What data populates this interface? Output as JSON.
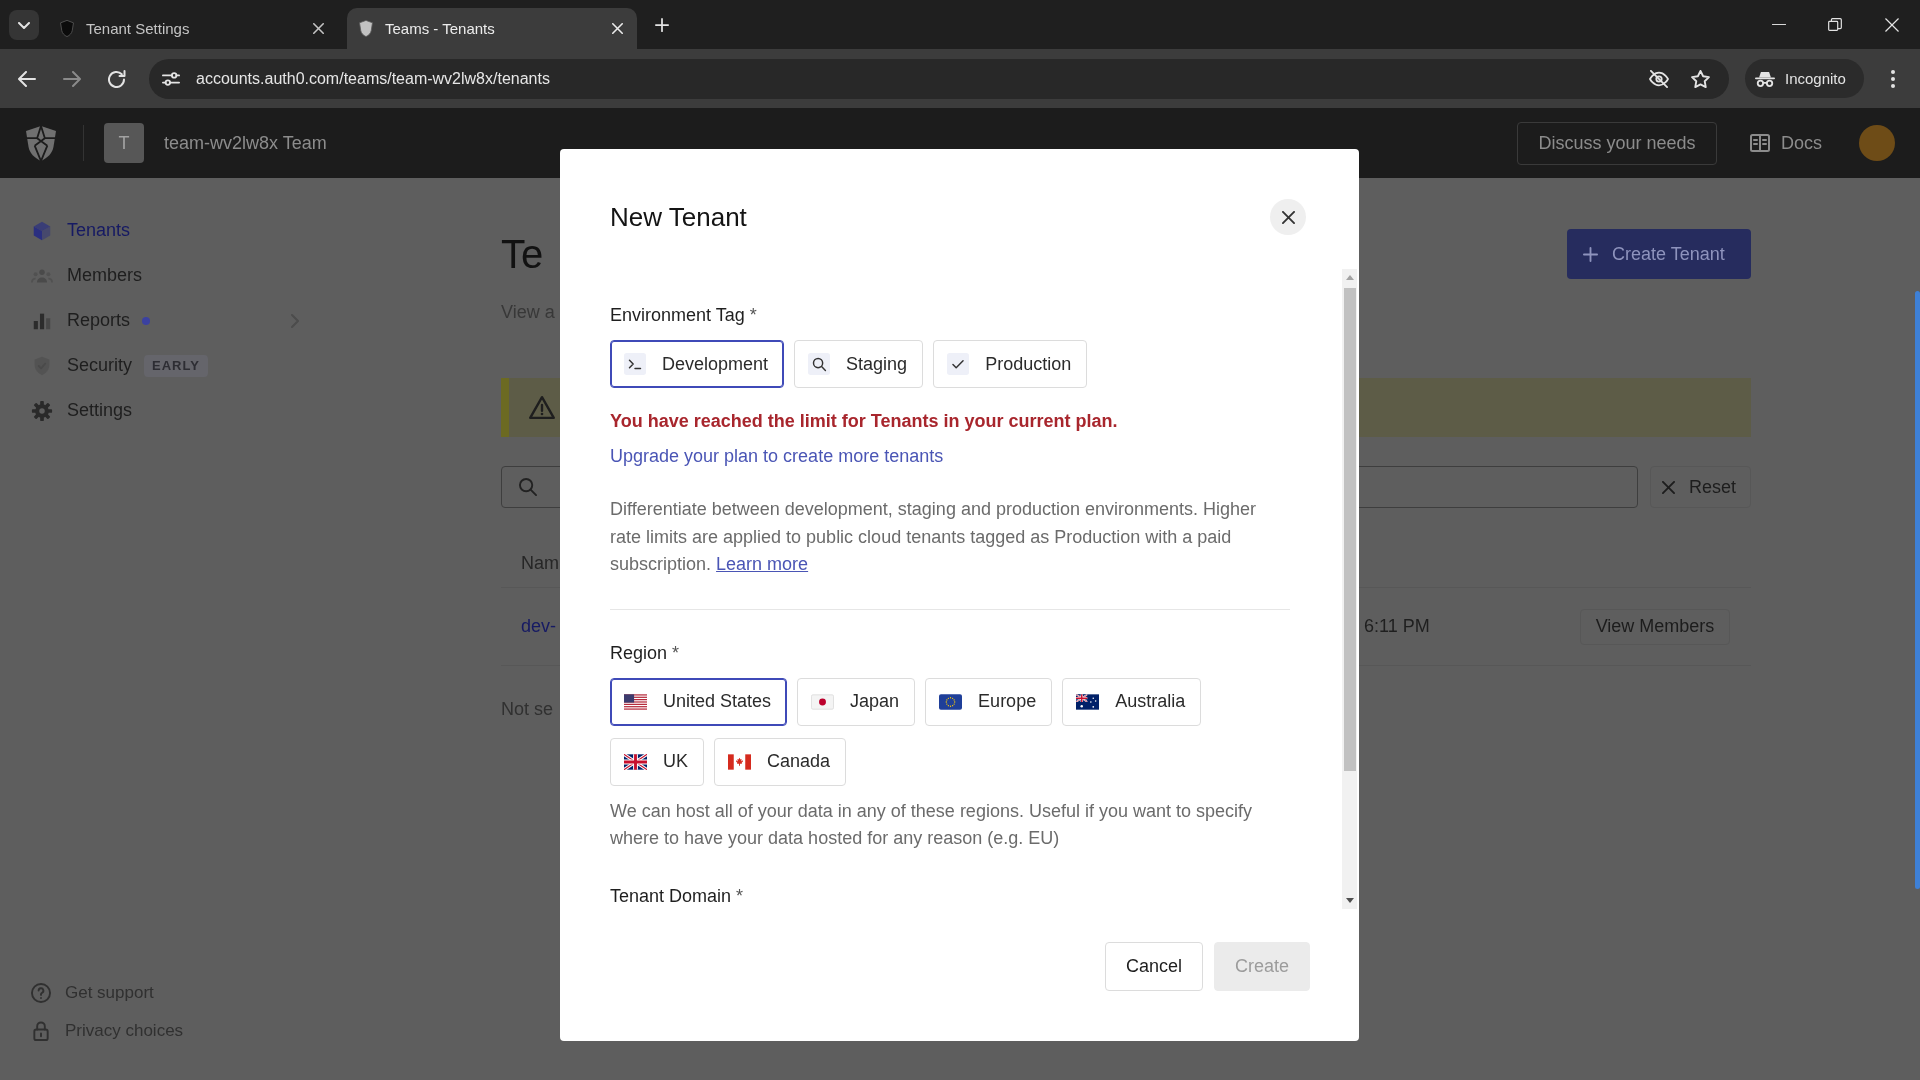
{
  "browser": {
    "tabs": [
      {
        "title": "Tenant Settings",
        "selected": false
      },
      {
        "title": "Teams - Tenants",
        "selected": true
      }
    ],
    "address": "accounts.auth0.com/teams/team-wv2lw8x/tenants",
    "profile": "Incognito"
  },
  "header": {
    "team_initial": "T",
    "team_name": "team-wv2lw8x Team",
    "discuss_button": "Discuss your needs",
    "docs_link": "Docs"
  },
  "sidebar": {
    "items": [
      {
        "label": "Tenants",
        "selected": true,
        "dot": false,
        "expandable": false
      },
      {
        "label": "Members",
        "selected": false,
        "dot": false,
        "expandable": false
      },
      {
        "label": "Reports",
        "selected": false,
        "dot": true,
        "expandable": true
      },
      {
        "label": "Security",
        "selected": false,
        "dot": false,
        "expandable": false,
        "badge": "EARLY"
      },
      {
        "label": "Settings",
        "selected": false,
        "dot": false,
        "expandable": false
      }
    ],
    "footer_links": [
      "Get support",
      "Privacy choices"
    ]
  },
  "page": {
    "title": "Te",
    "subtitle": "View a",
    "create_button": "Create Tenant",
    "reset_button": "Reset",
    "table": {
      "columns": [
        "Nam"
      ],
      "rows": [
        {
          "cells": [
            "dev-",
            "6:11 PM"
          ],
          "action": "View Members"
        }
      ]
    },
    "footer_note": "Not se"
  },
  "dialog": {
    "title": "New Tenant",
    "environment": {
      "label": "Environment Tag",
      "required_mark": "*",
      "options": [
        {
          "label": "Development",
          "selected": true
        },
        {
          "label": "Staging",
          "selected": false
        },
        {
          "label": "Production",
          "selected": false
        }
      ],
      "error": "You have reached the limit for Tenants in your current plan.",
      "upgrade_link": "Upgrade your plan to create more tenants",
      "help": "Differentiate between development, staging and production environments. Higher rate limits are applied to public cloud tenants tagged as Production with a paid subscription.",
      "help_link": "Learn more"
    },
    "region": {
      "label": "Region",
      "required_mark": "*",
      "options": [
        {
          "label": "United States",
          "selected": true
        },
        {
          "label": "Japan",
          "selected": false
        },
        {
          "label": "Europe",
          "selected": false
        },
        {
          "label": "Australia",
          "selected": false
        },
        {
          "label": "UK",
          "selected": false
        },
        {
          "label": "Canada",
          "selected": false
        }
      ],
      "help": "We can host all of your data in any of these regions. Useful if you want to specify where to have your data hosted for any reason (e.g. EU)"
    },
    "domain": {
      "label": "Tenant Domain",
      "required_mark": "*"
    },
    "buttons": [
      {
        "label": "Cancel",
        "disabled": false
      },
      {
        "label": "Create",
        "disabled": true
      }
    ]
  }
}
